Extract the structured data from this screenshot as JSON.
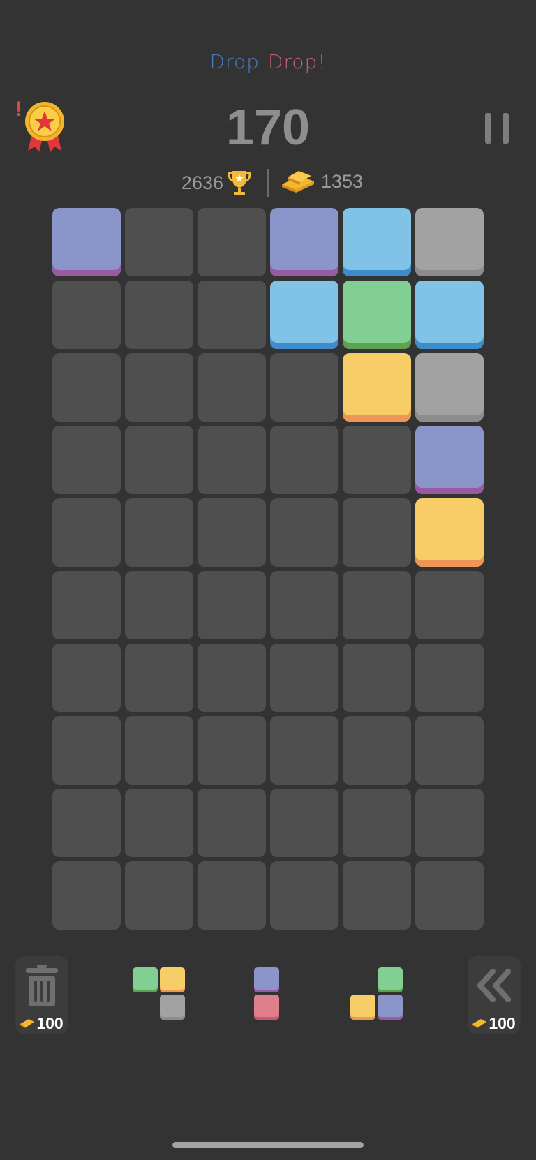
{
  "app": {
    "logo_word1": "Drop",
    "logo_word2": "Drop!"
  },
  "header": {
    "score": "170",
    "best_score": "2636",
    "gold": "1353",
    "achievement_alert": "!"
  },
  "board": {
    "columns": 6,
    "rows": 10,
    "tiles": [
      {
        "row": 0,
        "col": 0,
        "color": "purple"
      },
      {
        "row": 0,
        "col": 3,
        "color": "purple"
      },
      {
        "row": 0,
        "col": 4,
        "color": "blue"
      },
      {
        "row": 0,
        "col": 5,
        "color": "gray"
      },
      {
        "row": 1,
        "col": 3,
        "color": "blue"
      },
      {
        "row": 1,
        "col": 4,
        "color": "green"
      },
      {
        "row": 1,
        "col": 5,
        "color": "blue"
      },
      {
        "row": 2,
        "col": 4,
        "color": "yellow"
      },
      {
        "row": 2,
        "col": 5,
        "color": "gray"
      },
      {
        "row": 3,
        "col": 5,
        "color": "purple"
      },
      {
        "row": 4,
        "col": 5,
        "color": "yellow"
      }
    ]
  },
  "colors": {
    "background": "#333333",
    "cell": "#4f4f4f",
    "purple": "#8a95c9",
    "blue": "#80c3e6",
    "gray": "#a2a2a2",
    "green": "#82cf93",
    "yellow": "#f6cd66",
    "pink": "#e07f8c"
  },
  "tray": {
    "trash_cost": "100",
    "undo_cost": "100",
    "pieces": [
      {
        "name": "piece-1",
        "blocks": [
          {
            "r": 0,
            "c": 0,
            "color": "green"
          },
          {
            "r": 0,
            "c": 1,
            "color": "yellow"
          },
          {
            "r": 1,
            "c": 1,
            "color": "gray"
          }
        ]
      },
      {
        "name": "piece-2",
        "blocks": [
          {
            "r": 0,
            "c": 0,
            "color": "purple"
          },
          {
            "r": 1,
            "c": 0,
            "color": "pink"
          }
        ]
      },
      {
        "name": "piece-3",
        "blocks": [
          {
            "r": 0,
            "c": 1,
            "color": "green"
          },
          {
            "r": 1,
            "c": 0,
            "color": "yellow"
          },
          {
            "r": 1,
            "c": 1,
            "color": "purple"
          }
        ]
      }
    ]
  },
  "icons": {
    "medal": "medal-icon",
    "pause": "pause-icon",
    "trophy": "trophy-icon",
    "gold": "gold-bars-icon",
    "trash": "trash-icon",
    "undo": "undo-icon"
  }
}
